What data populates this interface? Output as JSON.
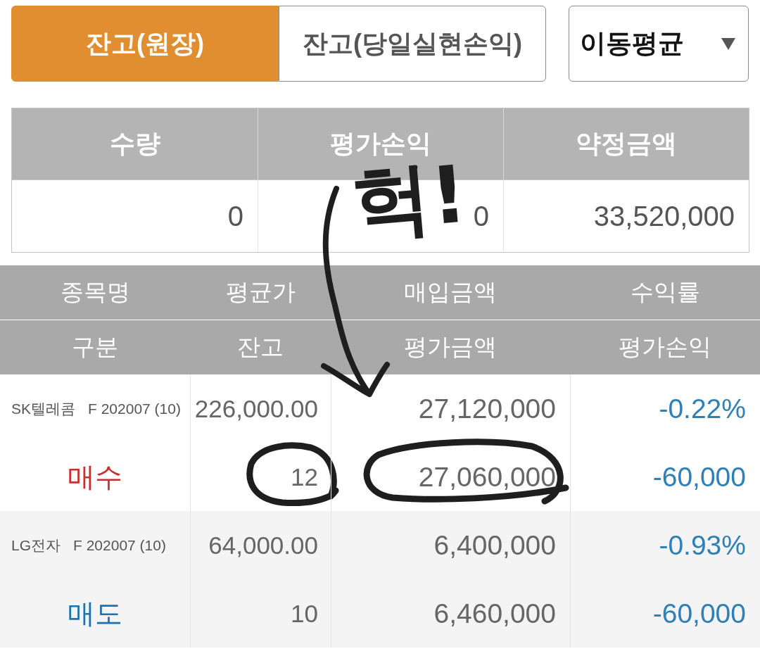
{
  "tabs": [
    {
      "label": "잔고(원장)",
      "selected": true
    },
    {
      "label": "잔고(당일실현손익)",
      "selected": false
    }
  ],
  "dropdown": {
    "value": "이동평균"
  },
  "summary": {
    "columns": [
      "수량",
      "평가손익",
      "약정금액"
    ],
    "values": [
      "0",
      "0",
      "33,520,000"
    ]
  },
  "positions": {
    "header_rows": [
      [
        "종목명",
        "평균가",
        "매입금액",
        "수익률"
      ],
      [
        "구분",
        "잔고",
        "평가금액",
        "평가손익"
      ]
    ],
    "rows": [
      {
        "name": "SK텔레콤",
        "contract": "F 202007 (10)",
        "avg_price": "226,000.00",
        "purchase_amount": "27,120,000",
        "return_rate": "-0.22%",
        "kind": "buy",
        "side": "매수",
        "balance": "12",
        "valuation": "27,060,000",
        "valuation_pl": "-60,000",
        "circled": true
      },
      {
        "name": "LG전자",
        "contract": "F 202007 (10)",
        "avg_price": "64,000.00",
        "purchase_amount": "6,400,000",
        "return_rate": "-0.93%",
        "kind": "sell",
        "side": "매도",
        "balance": "10",
        "valuation": "6,460,000",
        "valuation_pl": "-60,000",
        "circled": false
      }
    ]
  },
  "annotation": {
    "text": "헉!"
  }
}
